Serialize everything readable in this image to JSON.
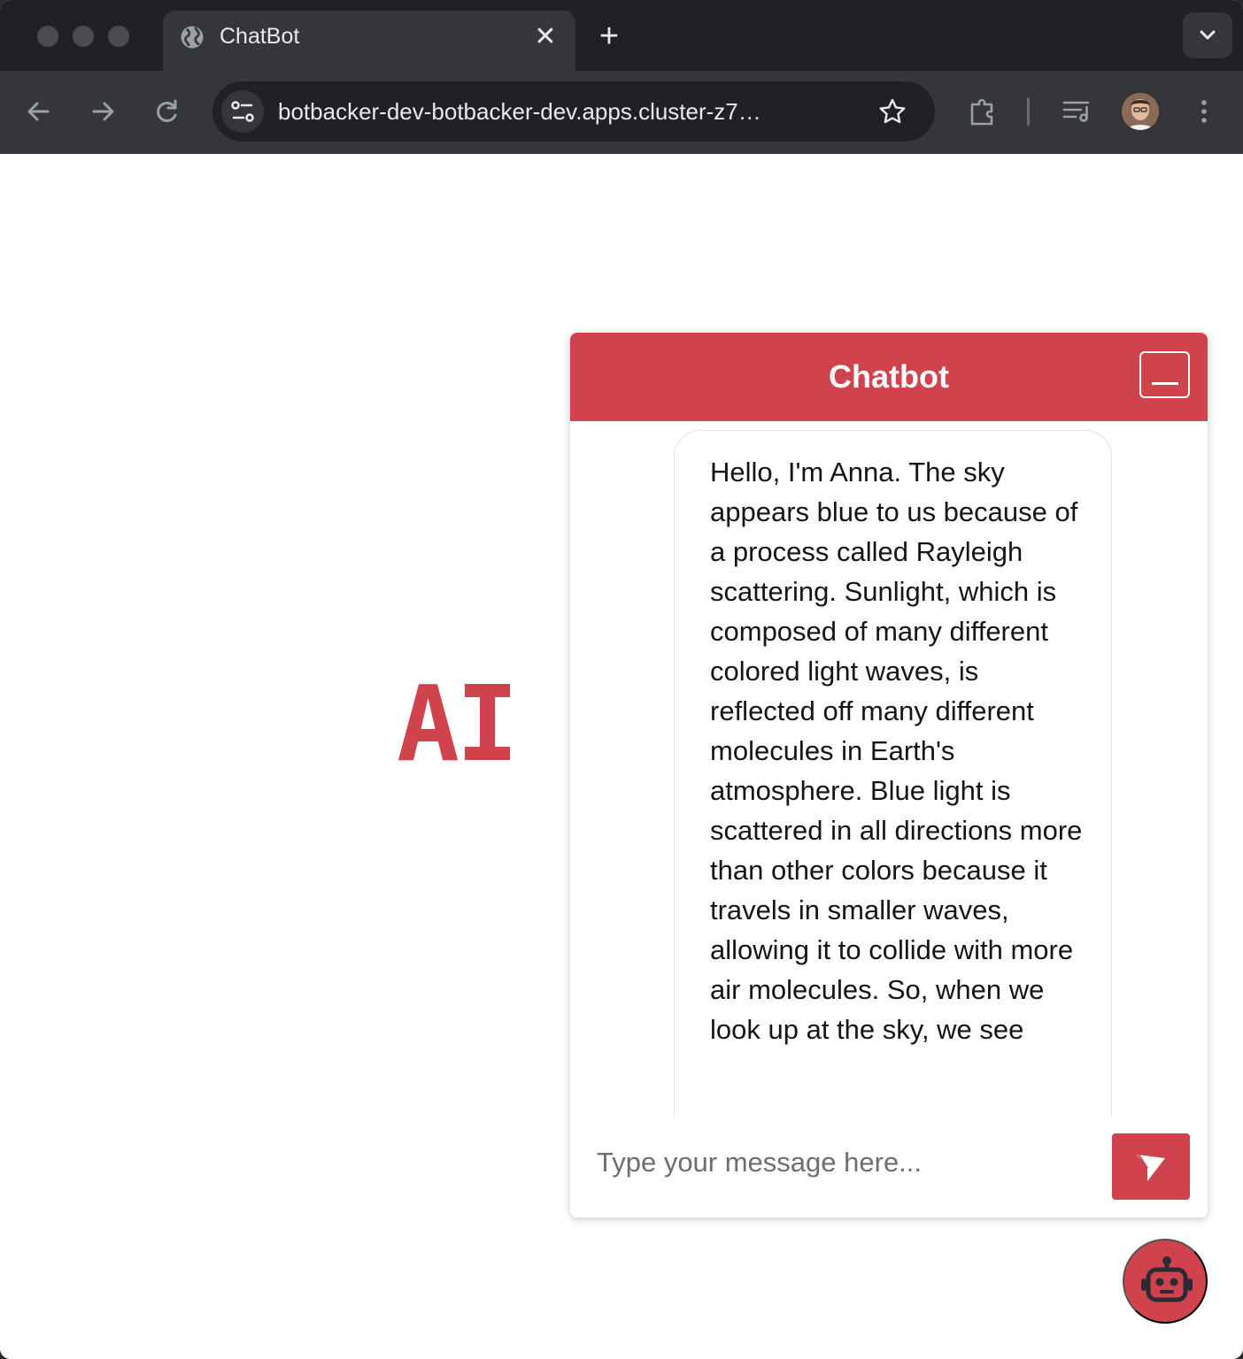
{
  "browser": {
    "tab": {
      "title": "ChatBot",
      "close_glyph": "✕"
    },
    "new_tab_glyph": "+",
    "url": "botbacker-dev-botbacker-dev.apps.cluster-z7…",
    "icons": {
      "back": "arrow-left-icon",
      "forward": "arrow-right-icon",
      "reload": "reload-icon",
      "site_info": "tune-icon",
      "bookmark": "star-icon",
      "extensions": "puzzle-icon",
      "media": "playlist-icon",
      "menu": "kebab-icon",
      "tab_search": "chevron-down-icon"
    },
    "colors": {
      "frame": "#202124",
      "toolbar": "#35363a",
      "text": "#e8eaed"
    }
  },
  "page": {
    "logo_text": "AI",
    "accent_color": "#d0424c"
  },
  "chat": {
    "title": "Chatbot",
    "messages": [
      {
        "role": "bot",
        "text": "Hello, I'm Anna. The sky appears blue to us because of a process called Rayleigh scattering. Sunlight, which is composed of many different colored light waves, is reflected off many different molecules in Earth's atmosphere. Blue light is scattered in all directions more than other colors because it travels in smaller waves, allowing it to collide with more air molecules. So, when we look up at the sky, we see"
      }
    ],
    "input": {
      "placeholder": "Type your message here...",
      "value": ""
    },
    "icons": {
      "send": "send-icon",
      "minimize": "minimize-icon",
      "fab": "robot-icon"
    }
  }
}
